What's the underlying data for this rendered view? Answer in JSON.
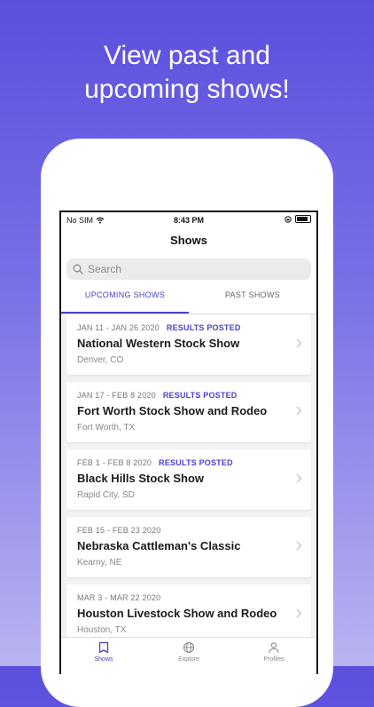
{
  "headline": {
    "line1": "View past and",
    "line2": "upcoming shows!"
  },
  "status_bar": {
    "carrier": "No SIM",
    "time": "8:43 PM"
  },
  "nav": {
    "title": "Shows"
  },
  "search": {
    "placeholder": "Search",
    "value": ""
  },
  "tabs": [
    {
      "label": "UPCOMING SHOWS",
      "active": true
    },
    {
      "label": "PAST SHOWS",
      "active": false
    }
  ],
  "shows": [
    {
      "dates": "JAN 11 - JAN 26 2020",
      "badge": "RESULTS POSTED",
      "title": "National Western Stock Show",
      "location": "Denver, CO"
    },
    {
      "dates": "JAN 17 - FEB 8 2020",
      "badge": "RESULTS POSTED",
      "title": "Fort Worth Stock Show and Rodeo",
      "location": "Fort Worth, TX"
    },
    {
      "dates": "FEB 1 - FEB 8 2020",
      "badge": "RESULTS POSTED",
      "title": "Black Hills Stock Show",
      "location": "Rapid City, SD"
    },
    {
      "dates": "FEB 15 - FEB 23 2020",
      "badge": "",
      "title": "Nebraska Cattleman's Classic",
      "location": "Kearny, NE"
    },
    {
      "dates": "MAR 3 - MAR 22 2020",
      "badge": "",
      "title": "Houston Livestock Show and Rodeo",
      "location": "Houston, TX"
    }
  ],
  "tab_bar": [
    {
      "label": "Shows",
      "icon": "book-icon",
      "active": true
    },
    {
      "label": "Explore",
      "icon": "globe-icon",
      "active": false
    },
    {
      "label": "Profiles",
      "icon": "person-icon",
      "active": false
    }
  ],
  "colors": {
    "accent": "#4b41c8",
    "gradient_top": "#5b4fde",
    "gradient_bottom": "#b9b4f1"
  }
}
